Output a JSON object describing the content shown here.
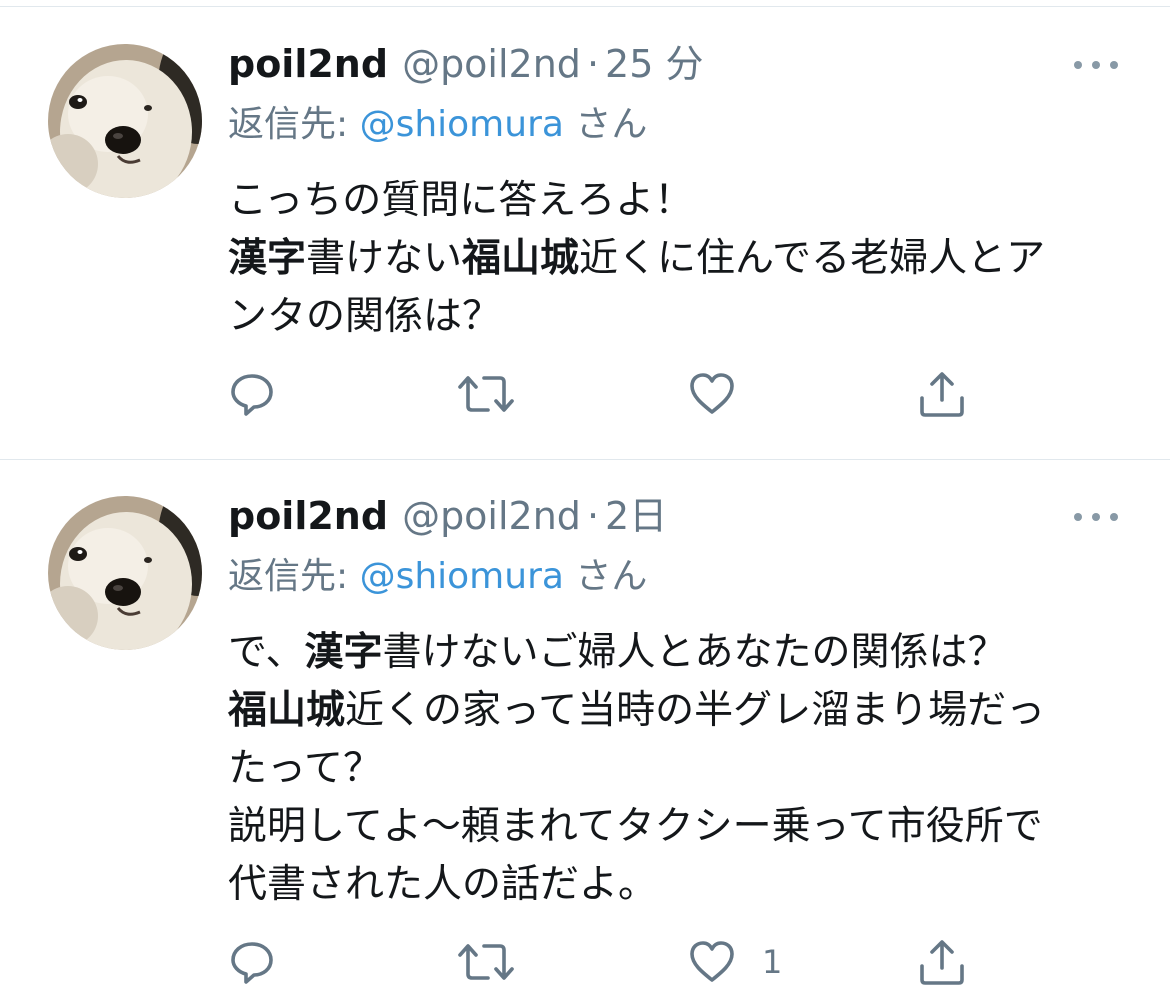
{
  "colors": {
    "name": "#14171a",
    "secondary": "#657786",
    "mention": "#3b94d9",
    "divider": "#e1e8ed",
    "icon": "#657786"
  },
  "tweets": [
    {
      "display_name": "poil2nd",
      "handle": "@poil2nd",
      "separator": "·",
      "time": "25 分",
      "reply_prefix": "返信先: ",
      "reply_to": "@shiomura",
      "reply_suffix": " さん",
      "lines": [
        [
          {
            "t": "こっちの質問に答えろよ！",
            "b": false
          }
        ],
        [
          {
            "t": "漢字",
            "b": true
          },
          {
            "t": "書けない",
            "b": false
          },
          {
            "t": "福山城",
            "b": true
          },
          {
            "t": "近くに住んでる老婦人とア",
            "b": false
          }
        ],
        [
          {
            "t": "ンタの関係は？",
            "b": false
          }
        ]
      ],
      "actions": {
        "reply_icon": "reply-icon",
        "retweet_icon": "retweet-icon",
        "like_icon": "heart-icon",
        "like_count": "",
        "share_icon": "share-icon"
      }
    },
    {
      "display_name": "poil2nd",
      "handle": "@poil2nd",
      "separator": "·",
      "time": "2日",
      "reply_prefix": "返信先: ",
      "reply_to": "@shiomura",
      "reply_suffix": " さん",
      "lines": [
        [
          {
            "t": "で、",
            "b": false
          },
          {
            "t": "漢字",
            "b": true
          },
          {
            "t": "書けないご婦人とあなたの関係は？",
            "b": false
          }
        ],
        [
          {
            "t": "福山城",
            "b": true
          },
          {
            "t": "近くの家って当時の半グレ溜まり場だっ",
            "b": false
          }
        ],
        [
          {
            "t": "たって？",
            "b": false
          }
        ],
        [
          {
            "t": "説明してよ〜頼まれてタクシー乗って市役所で",
            "b": false
          }
        ],
        [
          {
            "t": "代書された人の話だよ。",
            "b": false
          }
        ]
      ],
      "actions": {
        "reply_icon": "reply-icon",
        "retweet_icon": "retweet-icon",
        "like_icon": "heart-icon",
        "like_count": "1",
        "share_icon": "share-icon"
      }
    }
  ]
}
